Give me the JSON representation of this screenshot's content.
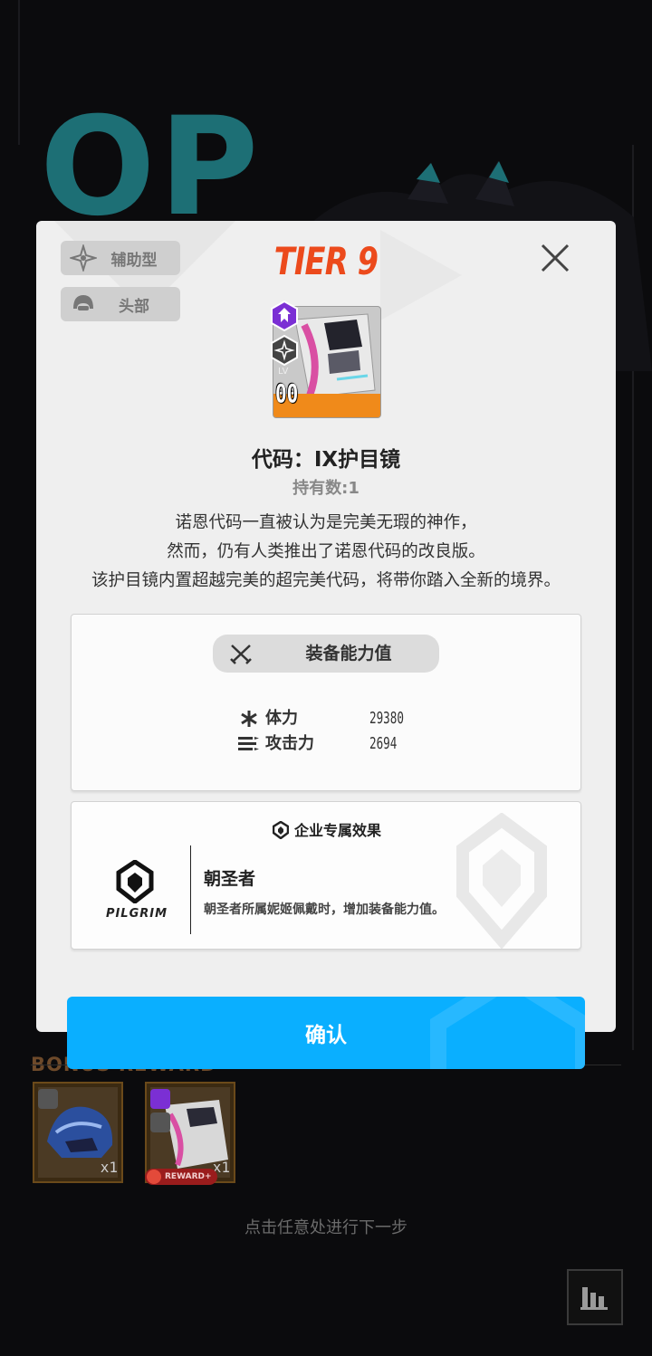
{
  "background": {
    "big_letters": "OP",
    "bonus_title": "BONUS REWARD",
    "rewards": [
      {
        "qty": "x1",
        "tag": ""
      },
      {
        "qty": "x1",
        "tag": "REWARD+"
      }
    ],
    "hint": "点击任意处进行下一步"
  },
  "modal": {
    "tags": [
      {
        "icon": "support-class-icon",
        "label": "辅助型"
      },
      {
        "icon": "helmet-icon",
        "label": "头部"
      }
    ],
    "tier": "TIER 9",
    "item": {
      "lv_label": "LV",
      "lv_value": "00",
      "name": "代码：IX护目镜",
      "owned": "持有数:1",
      "desc_lines": [
        "诺恩代码一直被认为是完美无瑕的神作，",
        "然而，仍有人类推出了诺恩代码的改良版。",
        "该护目镜内置超越完美的超完美代码，将带你踏入全新的境界。"
      ]
    },
    "stats": {
      "header": "装备能力值",
      "rows": [
        {
          "icon": "hp-icon",
          "name": "体力",
          "value": "29380"
        },
        {
          "icon": "attack-icon",
          "name": "攻击力",
          "value": "2694"
        }
      ]
    },
    "effect": {
      "header": "企业专属效果",
      "company": "PILGRIM",
      "title": "朝圣者",
      "desc": "朝圣者所属妮姬佩戴时，增加装备能力值。"
    },
    "confirm": "确认"
  },
  "colors": {
    "accent_blue": "#0aafff",
    "tier_orange": "#ec4a1c",
    "rarity_purple": "#7b2fd4",
    "band_orange": "#f08a1a"
  }
}
